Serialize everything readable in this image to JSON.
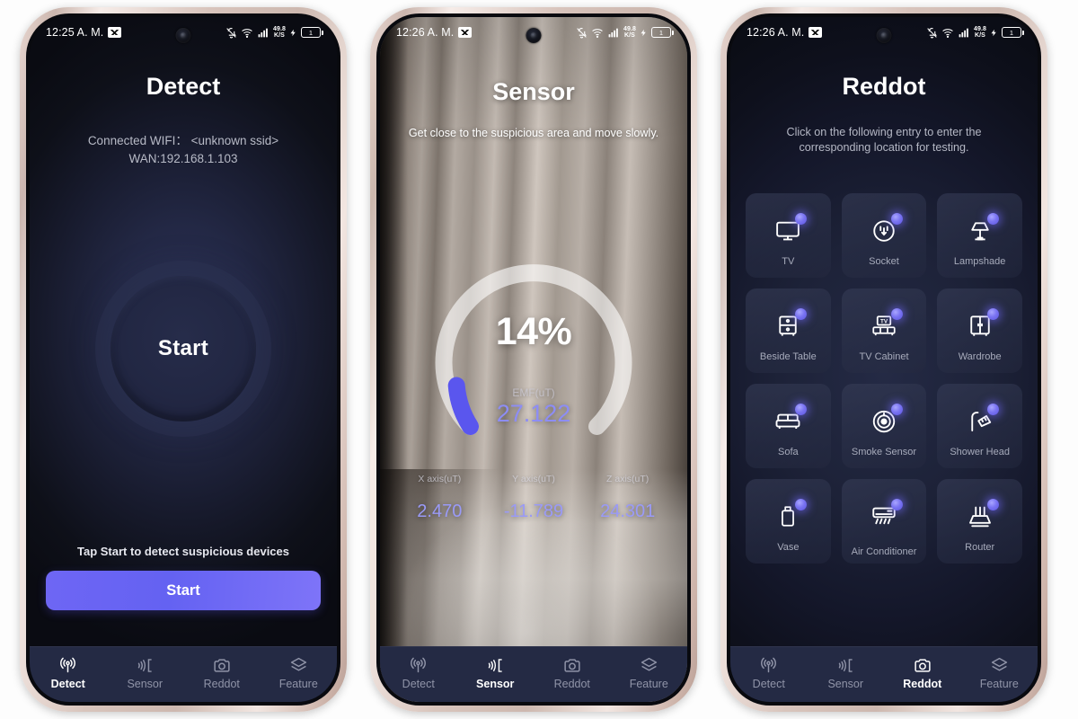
{
  "statusbar": {
    "time_phone1": "12:25 A. M.",
    "time_phone2": "12:26 A. M.",
    "time_phone3": "12:26 A. M.",
    "network_speed": "49.8",
    "network_speed_unit": "K/S",
    "battery_level": "1",
    "icons": [
      "network-activity-icon",
      "bell-off-icon",
      "wifi-icon",
      "signal-bars-icon",
      "charging-bolt-icon",
      "battery-icon"
    ]
  },
  "nav": {
    "items": [
      {
        "label": "Detect",
        "icon": "radio-antenna-icon"
      },
      {
        "label": "Sensor",
        "icon": "sensor-waves-icon"
      },
      {
        "label": "Reddot",
        "icon": "camera-icon"
      },
      {
        "label": "Feature",
        "icon": "layers-icon"
      }
    ]
  },
  "detect": {
    "title": "Detect",
    "wifi_line": "Connected WIFI： <unknown ssid>",
    "wan_line": "WAN:192.168.1.103",
    "circle_label": "Start",
    "hint": "Tap Start to detect suspicious devices",
    "start_button": "Start",
    "active_nav": "Detect",
    "accent": "#6a62f3"
  },
  "sensor": {
    "title": "Sensor",
    "subtitle": "Get close to the suspicious area and move slowly.",
    "percent": "14%",
    "emf_label": "EMF(uT)",
    "emf_value": "27.122",
    "axes": [
      {
        "label": "X axis(uT)",
        "value": "2.470"
      },
      {
        "label": "Y axis(uT)",
        "value": "-11.789"
      },
      {
        "label": "Z axis(uT)",
        "value": "24.301"
      }
    ],
    "active_nav": "Sensor",
    "gauge_progress_color": "#5a56ee",
    "gauge_track_color": "rgba(255,255,255,0.62)"
  },
  "reddot": {
    "title": "Reddot",
    "subtitle": "Click on the following entry to enter the corresponding location for testing.",
    "items": [
      {
        "label": "TV",
        "icon": "tv-icon"
      },
      {
        "label": "Socket",
        "icon": "socket-icon"
      },
      {
        "label": "Lampshade",
        "icon": "lampshade-icon"
      },
      {
        "label": "Beside Table",
        "icon": "bedside-table-icon"
      },
      {
        "label": "TV Cabinet",
        "icon": "tv-cabinet-icon"
      },
      {
        "label": "Wardrobe",
        "icon": "wardrobe-icon"
      },
      {
        "label": "Sofa",
        "icon": "sofa-icon"
      },
      {
        "label": "Smoke Sensor",
        "icon": "smoke-sensor-icon"
      },
      {
        "label": "Shower Head",
        "icon": "shower-head-icon"
      },
      {
        "label": "Vase",
        "icon": "vase-icon"
      },
      {
        "label": "Air Conditioner",
        "icon": "air-conditioner-icon"
      },
      {
        "label": "Router",
        "icon": "router-icon"
      }
    ],
    "active_nav": "Reddot",
    "dot_color": "#7a74f2"
  }
}
